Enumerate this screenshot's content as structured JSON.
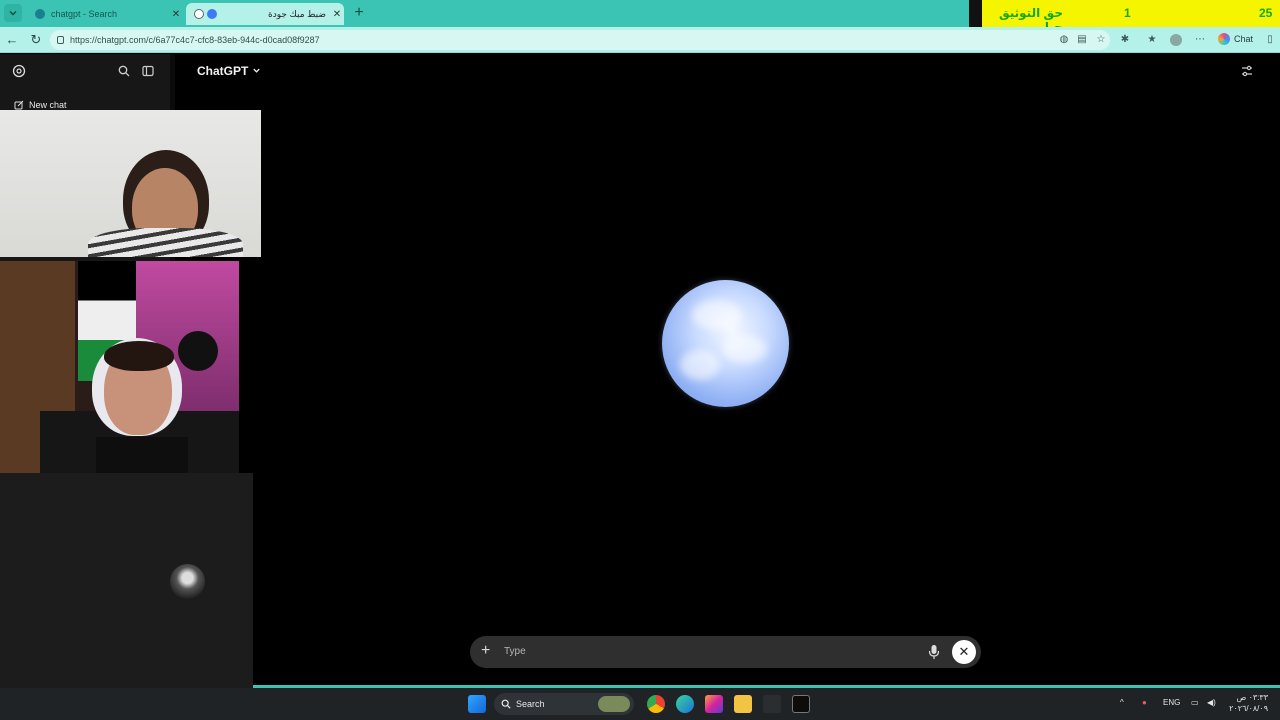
{
  "browser": {
    "tabs": [
      {
        "title": "chatgpt - Search",
        "active": false
      },
      {
        "title": "ضبط مبك جودة",
        "active": true
      }
    ],
    "url": "https://chatgpt.com/c/6a77c4c7-cfc8-83eb-944c-d0cad08f9287",
    "chat_label": "Chat"
  },
  "banner": {
    "left_number": "25",
    "middle_number": "1",
    "text": "حق التوثيق حبايبي"
  },
  "app": {
    "sidebar_new_chat": "New chat",
    "model_name": "ChatGPT",
    "input_placeholder": "Type"
  },
  "taskbar": {
    "search_label": "Search",
    "language": "ENG",
    "time": "٠٣:٣٣ ص",
    "date": "٢٠٢٦/٠٨/٠٩"
  },
  "colors": {
    "tab_bar": "#3bc4b4",
    "address_bar": "#b4f1e8",
    "banner": "#f6f500",
    "banner_text": "#17a817"
  }
}
